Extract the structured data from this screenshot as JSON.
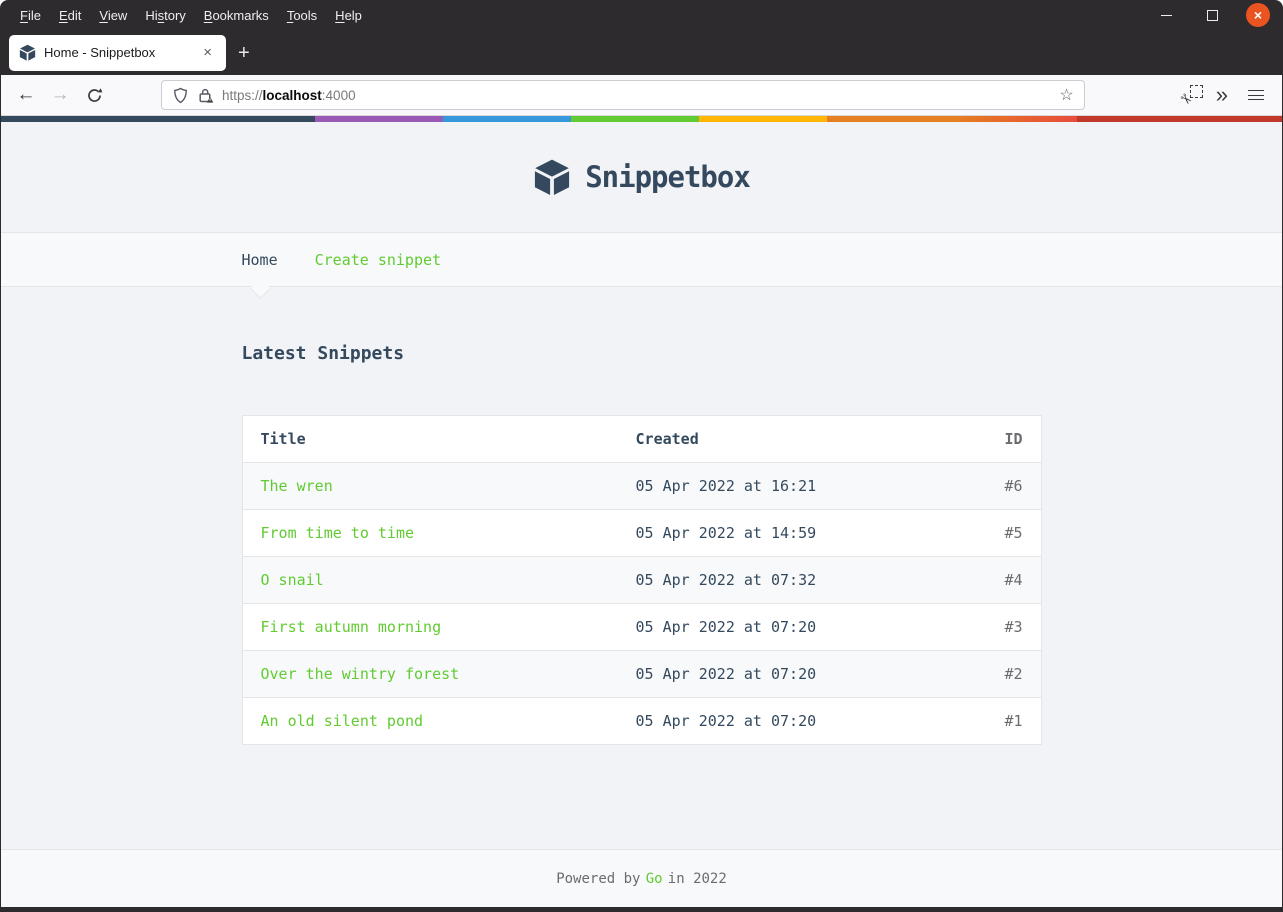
{
  "menubar": {
    "items": [
      {
        "label": "File",
        "u": 0
      },
      {
        "label": "Edit",
        "u": 0
      },
      {
        "label": "View",
        "u": 0
      },
      {
        "label": "History",
        "u": 2
      },
      {
        "label": "Bookmarks",
        "u": 0
      },
      {
        "label": "Tools",
        "u": 0
      },
      {
        "label": "Help",
        "u": 0
      }
    ],
    "close_glyph": "×"
  },
  "tabbar": {
    "active_tab_title": "Home - Snippetbox",
    "tab_close_glyph": "×",
    "new_tab_glyph": "+"
  },
  "toolbar": {
    "back_glyph": "←",
    "forward_glyph": "→",
    "url": {
      "scheme": "https://",
      "host": "localhost",
      "port": ":4000"
    },
    "bookmark_star_glyph": "☆",
    "scissors_glyph": "✂",
    "overflow_glyph": "»"
  },
  "page": {
    "brand": "Snippetbox",
    "nav": {
      "items": [
        {
          "label": "Home",
          "active": true
        },
        {
          "label": "Create snippet",
          "active": false
        }
      ]
    },
    "heading": "Latest Snippets",
    "table": {
      "headers": {
        "title": "Title",
        "created": "Created",
        "id": "ID"
      },
      "rows": [
        {
          "title": "The wren",
          "created": "05 Apr 2022 at 16:21",
          "id": "#6"
        },
        {
          "title": "From time to time",
          "created": "05 Apr 2022 at 14:59",
          "id": "#5"
        },
        {
          "title": "O snail",
          "created": "05 Apr 2022 at 07:32",
          "id": "#4"
        },
        {
          "title": "First autumn morning",
          "created": "05 Apr 2022 at 07:20",
          "id": "#3"
        },
        {
          "title": "Over the wintry forest",
          "created": "05 Apr 2022 at 07:20",
          "id": "#2"
        },
        {
          "title": "An old silent pond",
          "created": "05 Apr 2022 at 07:20",
          "id": "#1"
        }
      ]
    },
    "footer": {
      "prefix": "Powered by",
      "link": "Go",
      "suffix": "in 2022"
    }
  },
  "colors": {
    "brand_slate": "#34495E",
    "accent_green": "#62CB31",
    "muted_gray": "#6A6C6F",
    "page_bg": "#F1F3F6",
    "panel_bg": "#F7F9FA",
    "border": "#E4E5E7",
    "chrome_dark": "#2e2b2e",
    "close_button_orange": "#E95420",
    "stripe": [
      "#34495E",
      "#9B59B6",
      "#3498DB",
      "#62CB31",
      "#FFB606",
      "#E67E22",
      "#E74C3C",
      "#C0392B"
    ]
  }
}
